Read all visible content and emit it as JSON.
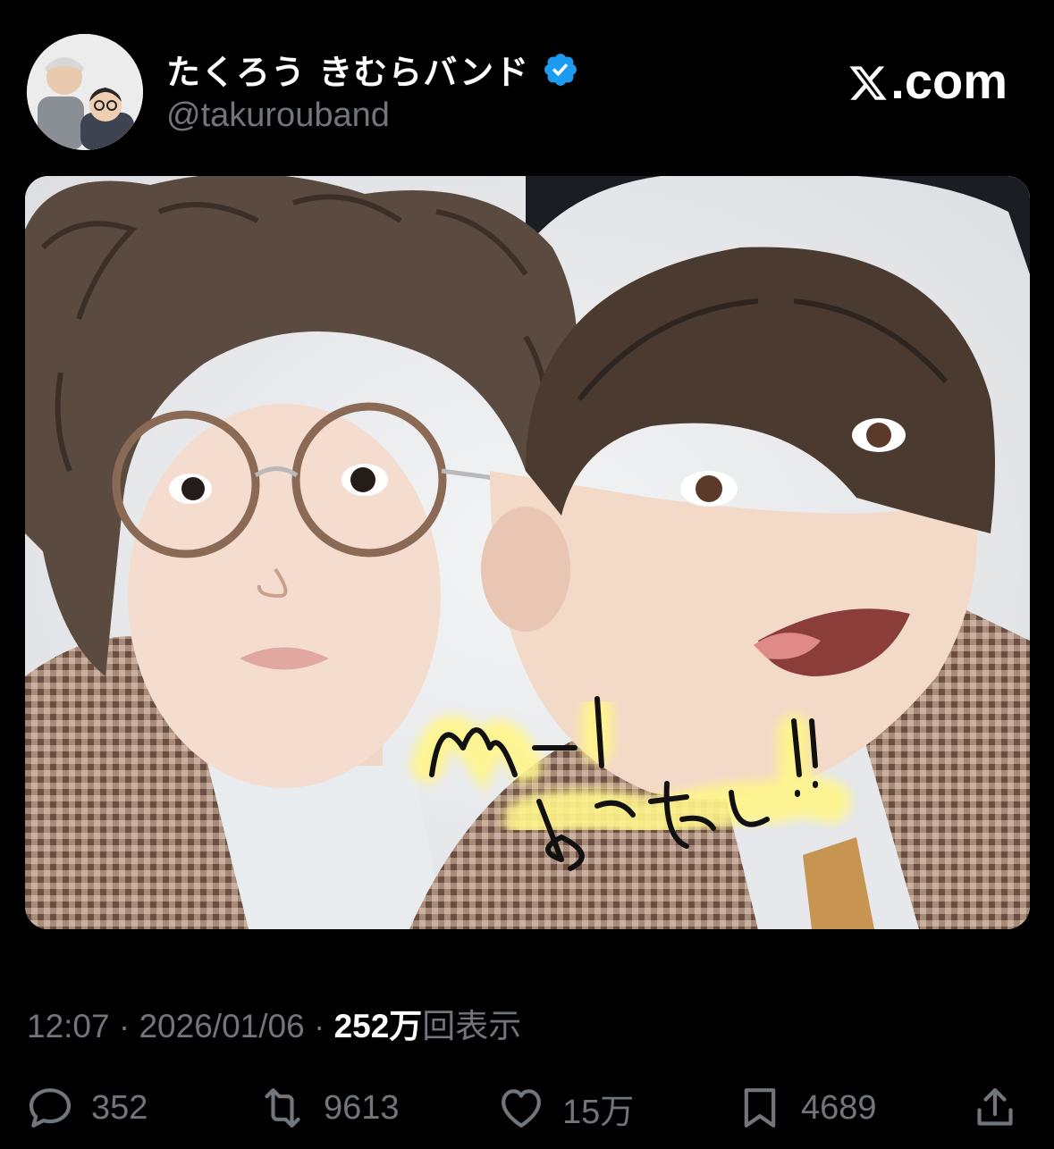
{
  "post": {
    "author": {
      "display_name": "たくろう きむらバンド",
      "handle": "@takurouband",
      "verified": true,
      "avatar_icon": "avatar-photo-icon",
      "verified_icon": "verified-badge-icon"
    },
    "brand": {
      "logo_icon": "x-logo-icon",
      "label": ".com"
    },
    "image": {
      "handwritten_caption": "M-1 とったし!!"
    },
    "meta": {
      "time": "12:07",
      "separator": " · ",
      "date": "2026/01/06",
      "views_count": "252万",
      "views_label": "回表示"
    },
    "actions": {
      "replies": {
        "icon": "reply-icon",
        "count": "352"
      },
      "reposts": {
        "icon": "repost-icon",
        "count": "9613"
      },
      "likes": {
        "icon": "heart-icon",
        "count": "15万"
      },
      "bookmarks": {
        "icon": "bookmark-icon",
        "count": "4689"
      },
      "share": {
        "icon": "share-icon"
      }
    },
    "colors": {
      "background": "#000000",
      "primary_text": "#ffffff",
      "secondary_text": "#71767b",
      "verified_blue": "#1d9bf0"
    }
  }
}
